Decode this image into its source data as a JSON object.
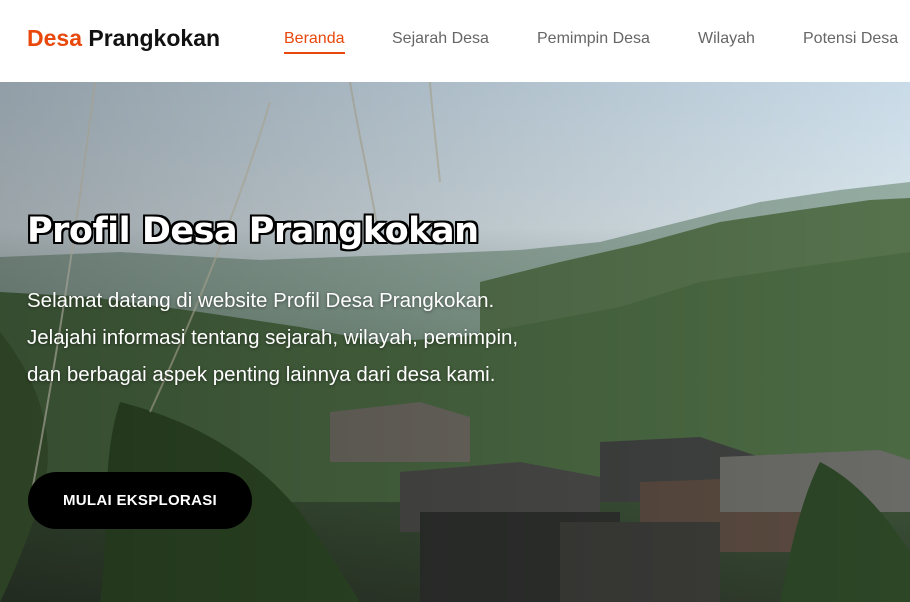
{
  "brand": {
    "accent": "Desa",
    "rest": "Prangkokan"
  },
  "nav": {
    "items": [
      {
        "label": "Beranda",
        "active": true
      },
      {
        "label": "Sejarah Desa",
        "active": false
      },
      {
        "label": "Pemimpin Desa",
        "active": false
      },
      {
        "label": "Wilayah",
        "active": false
      },
      {
        "label": "Potensi Desa",
        "active": false
      }
    ]
  },
  "hero": {
    "title": "Profil Desa Prangkokan",
    "description": "Selamat datang di website Profil Desa Prangkokan. Jelajahi informasi tentang sejarah, wilayah, pemimpin, dan berbagai aspek penting lainnya dari desa kami.",
    "cta_label": "MULAI EKSPLORASI"
  },
  "colors": {
    "accent": "#e8480c",
    "text_dark": "#111111",
    "nav_text": "#666666",
    "button_bg": "#000000"
  }
}
